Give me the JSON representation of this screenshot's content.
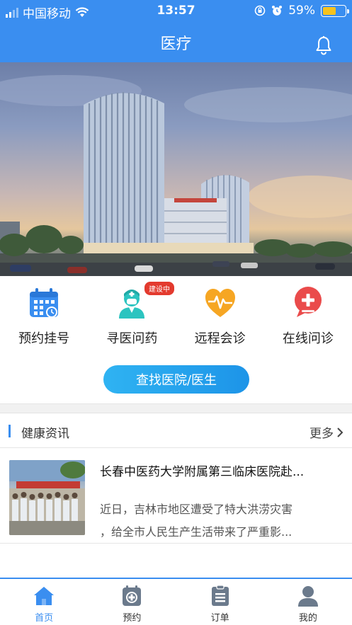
{
  "status_bar": {
    "carrier": "中国移动",
    "time": "13:57",
    "battery": "59%",
    "battery_level": 0.59
  },
  "header": {
    "title": "医疗",
    "bell_icon": "bell-icon"
  },
  "hero": {
    "image": "hospital-building-photo"
  },
  "quick_actions": [
    {
      "label": "预约挂号",
      "icon": "calendar-icon",
      "color": "#3a8ef0"
    },
    {
      "label": "寻医问药",
      "icon": "doctor-icon",
      "color": "#2cc4c0",
      "badge": "建设中"
    },
    {
      "label": "远程会诊",
      "icon": "heart-pulse-icon",
      "color": "#f6a623"
    },
    {
      "label": "在线问诊",
      "icon": "chat-plus-icon",
      "color": "#ea4b4b"
    }
  ],
  "find_button": "查找医院/医生",
  "news": {
    "section_title": "健康资讯",
    "more": "更多",
    "items": [
      {
        "title": "长春中医药大学附属第三临床医院赴...",
        "desc_line1": "近日，吉林市地区遭受了特大洪涝灾害",
        "desc_line2": "，给全市人民生产生活带来了严重影..."
      }
    ]
  },
  "tabbar": {
    "active": "home",
    "items": [
      {
        "label": "首页",
        "icon": "home-icon"
      },
      {
        "label": "预约",
        "icon": "appointment-icon"
      },
      {
        "label": "订单",
        "icon": "order-list-icon"
      },
      {
        "label": "我的",
        "icon": "user-icon"
      }
    ]
  },
  "colors": {
    "primary": "#3a8ef0",
    "badge": "#e33a2e"
  }
}
